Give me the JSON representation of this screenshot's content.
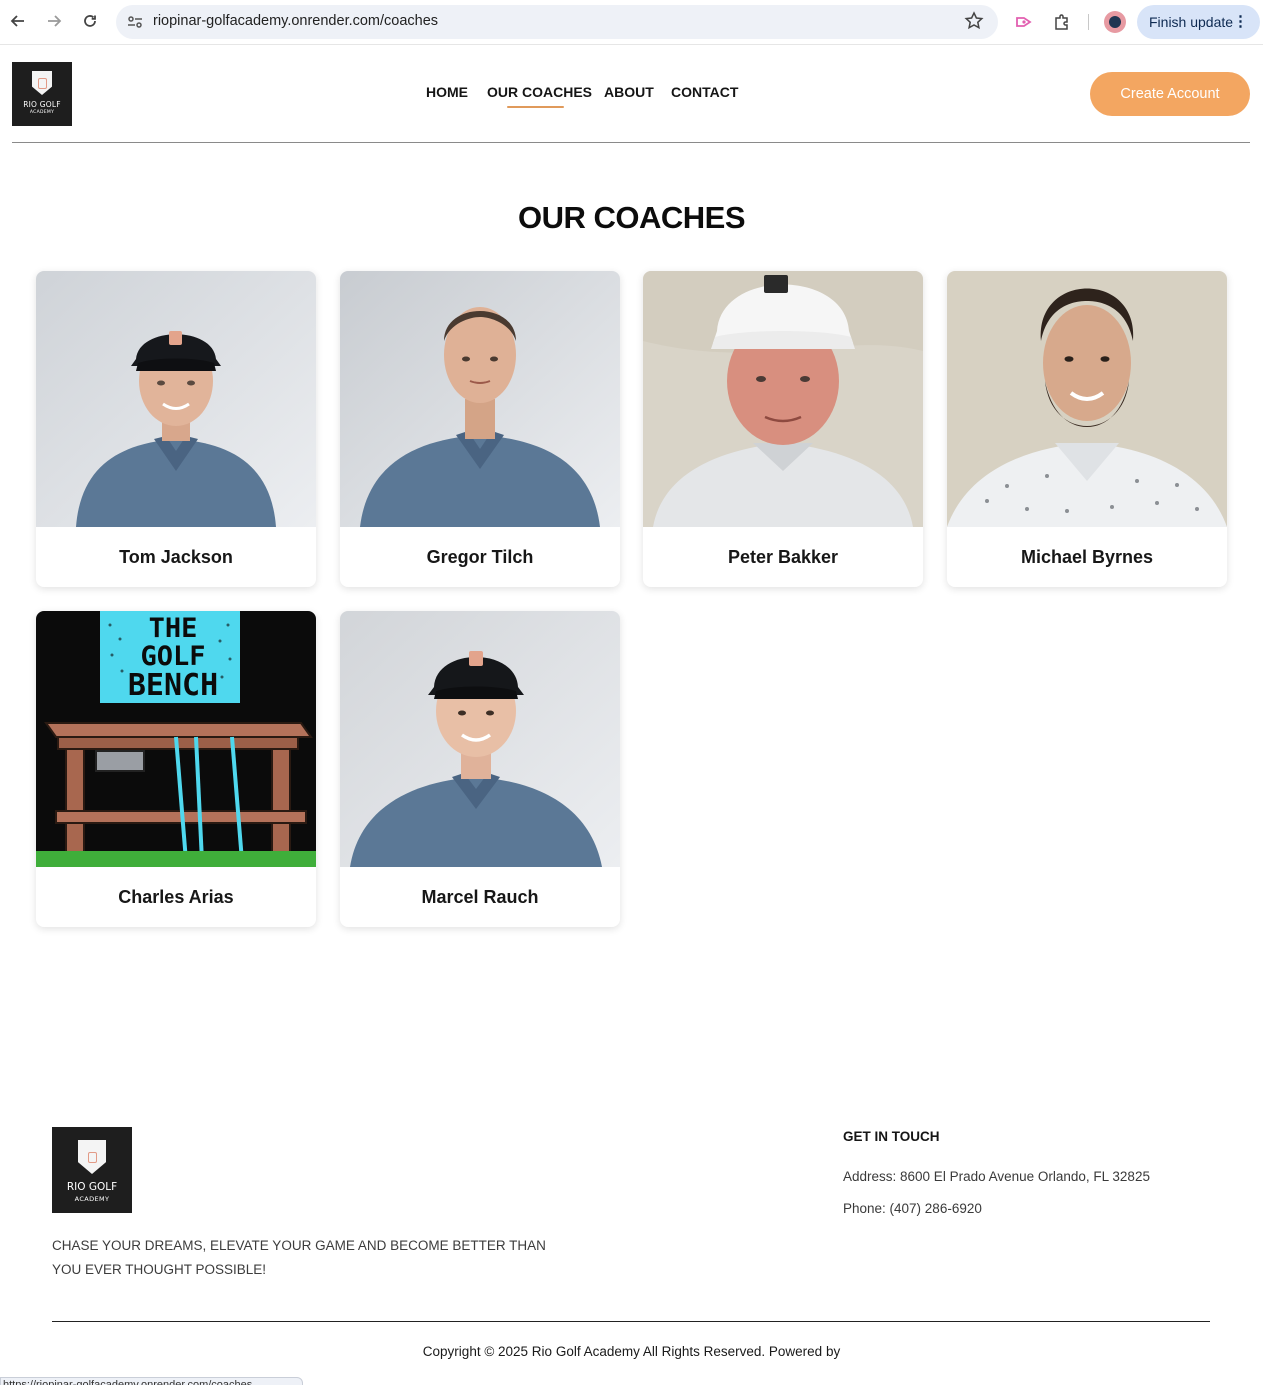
{
  "browser": {
    "url": "riopinar-golfacademy.onrender.com/coaches",
    "finish_update_label": "Finish update",
    "status_url": "https://riopinar-golfacademy.onrender.com/coaches"
  },
  "site": {
    "logo": {
      "line1": "RIO GOLF",
      "line2": "ACADEMY"
    },
    "nav": [
      {
        "label": "HOME"
      },
      {
        "label": "OUR COACHES",
        "active": true
      },
      {
        "label": "ABOUT"
      },
      {
        "label": "CONTACT"
      }
    ],
    "create_account_label": "Create Account",
    "accent_color": "#f3a661"
  },
  "main": {
    "title": "OUR COACHES",
    "coaches": [
      {
        "name": "Tom Jackson"
      },
      {
        "name": "Gregor Tilch"
      },
      {
        "name": "Peter Bakker"
      },
      {
        "name": "Michael Byrnes"
      },
      {
        "name": "Charles Arias",
        "photo_text": [
          "THE",
          "GOLF",
          "BENCH"
        ]
      },
      {
        "name": "Marcel Rauch"
      }
    ]
  },
  "footer": {
    "logo": {
      "line1": "RIO GOLF",
      "line2": "ACADEMY"
    },
    "tagline": "CHASE YOUR DREAMS, ELEVATE YOUR GAME AND BECOME BETTER THAN YOU EVER THOUGHT POSSIBLE!",
    "get_in_touch_title": "GET IN TOUCH",
    "address": "Address: 8600 El Prado Avenue Orlando, FL 32825",
    "phone": "Phone: (407) 286-6920",
    "copyright": "Copyright © 2025 Rio Golf Academy All Rights Reserved. Powered by"
  }
}
